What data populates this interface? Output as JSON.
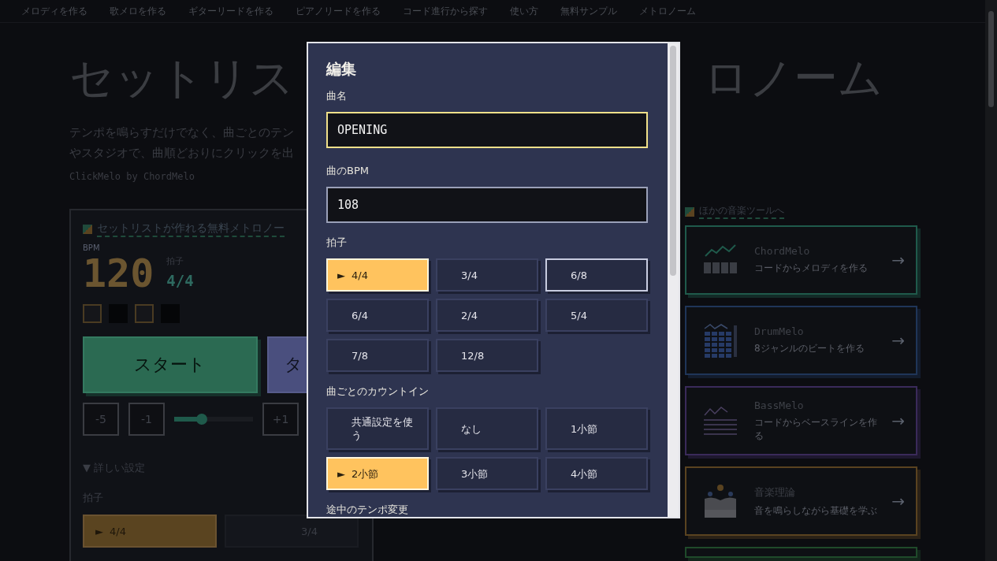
{
  "nav": [
    "メロディを作る",
    "歌メロを作る",
    "ギターリードを作る",
    "ピアノリードを作る",
    "コード進行から探す",
    "使い方",
    "無料サンプル",
    "メトロノーム"
  ],
  "heading": {
    "left": "セットリス",
    "right": "ロノーム"
  },
  "description": [
    "テンポを鳴らすだけでなく、曲ごとのテン",
    "やスタジオで、曲順どおりにクリックを出"
  ],
  "byline": "ClickMelo by ChordMelo",
  "metronome": {
    "title": "セットリストが作れる無料メトロノー",
    "bpm_label": "BPM",
    "bpm": "120",
    "meter_label": "拍子",
    "meter": "4/4",
    "beats": [
      {
        "kind": "hollow"
      },
      {
        "kind": "solid"
      },
      {
        "kind": "hollow"
      },
      {
        "kind": "solid"
      }
    ],
    "start": "スタート",
    "tap": "タ",
    "steps": [
      "-5",
      "-1"
    ],
    "tempo_slider": {
      "level": 0.35
    },
    "step_up": "+1",
    "details": "▼ 詳しい設定",
    "meter_heading": "拍子",
    "meter_options": [
      {
        "label": "4/4",
        "marker": "►",
        "selected": true
      },
      {
        "label": "3/4",
        "selected": false
      }
    ]
  },
  "tools": {
    "title": "ほかの音楽ツールへ",
    "arrow": "→",
    "items": [
      {
        "name": "ChordMelo",
        "desc": "コードからメロディを作る",
        "color": "#1f5a4b",
        "kind": "chord"
      },
      {
        "name": "DrumMelo",
        "desc": "8ジャンルのビートを作る",
        "color": "#1f3558",
        "kind": "drum"
      },
      {
        "name": "BassMelo",
        "desc": "コードからベースラインを作る",
        "color": "#3a2a5a",
        "kind": "bass"
      },
      {
        "name": "音楽理論",
        "desc": "音を鳴らしながら基礎を学ぶ",
        "color": "#5a4320",
        "kind": "theory"
      },
      {
        "color": "#1f4a2a",
        "kind": "edge"
      }
    ]
  },
  "dialog": {
    "title": "編集",
    "name_label": "曲名",
    "name_value": "OPENING",
    "bpm_label": "曲のBPM",
    "bpm_value": "108",
    "meter_label": "拍子",
    "meter_options": [
      {
        "label": "4/4",
        "marker": "►",
        "selected": true,
        "focused": false
      },
      {
        "label": "3/4",
        "selected": false,
        "focused": false
      },
      {
        "label": "6/8",
        "selected": false,
        "focused": true
      },
      {
        "label": "6/4",
        "selected": false,
        "focused": false
      },
      {
        "label": "2/4",
        "selected": false,
        "focused": false
      },
      {
        "label": "5/4",
        "selected": false,
        "focused": false
      },
      {
        "label": "7/8",
        "selected": false,
        "focused": false
      },
      {
        "label": "12/8",
        "selected": false,
        "focused": false
      }
    ],
    "countin_label": "曲ごとのカウントイン",
    "countin_options": [
      {
        "label": "共通設定を使う",
        "selected": false
      },
      {
        "label": "なし",
        "selected": false
      },
      {
        "label": "1小節",
        "selected": false
      },
      {
        "label": "2小節",
        "marker": "►",
        "selected": true
      },
      {
        "label": "3小節",
        "selected": false
      },
      {
        "label": "4小節",
        "selected": false
      }
    ],
    "tempo_change_label": "途中のテンポ変更"
  }
}
